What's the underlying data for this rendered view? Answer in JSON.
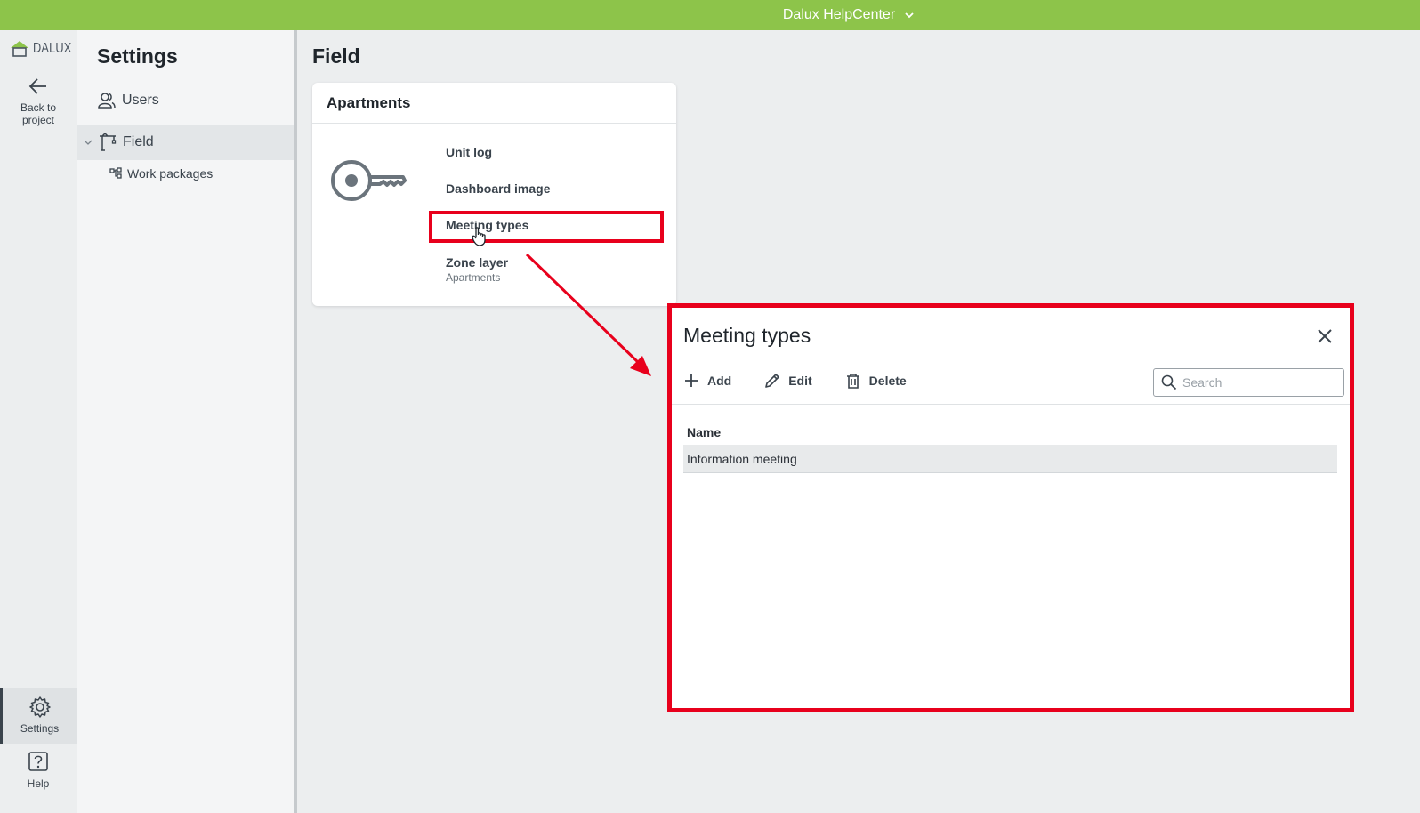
{
  "topbar": {
    "title": "Dalux HelpCenter"
  },
  "rail": {
    "logo_text": "DALUX",
    "back_label_line1": "Back to",
    "back_label_line2": "project",
    "settings_label": "Settings",
    "help_label": "Help"
  },
  "settings": {
    "title": "Settings",
    "items": [
      {
        "label": "Users"
      },
      {
        "label": "Field"
      },
      {
        "label": "Work packages"
      }
    ]
  },
  "main": {
    "title": "Field",
    "card": {
      "title": "Apartments",
      "links": [
        {
          "label": "Unit log"
        },
        {
          "label": "Dashboard image"
        },
        {
          "label": "Meeting types"
        },
        {
          "label": "Zone layer",
          "sub": "Apartments"
        }
      ]
    }
  },
  "dialog": {
    "title": "Meeting types",
    "toolbar": {
      "add": "Add",
      "edit": "Edit",
      "delete": "Delete"
    },
    "search_placeholder": "Search",
    "column": "Name",
    "rows": [
      {
        "name": "Information meeting"
      }
    ]
  },
  "colors": {
    "brand_green": "#8dc44a",
    "highlight_red": "#e8001c"
  }
}
